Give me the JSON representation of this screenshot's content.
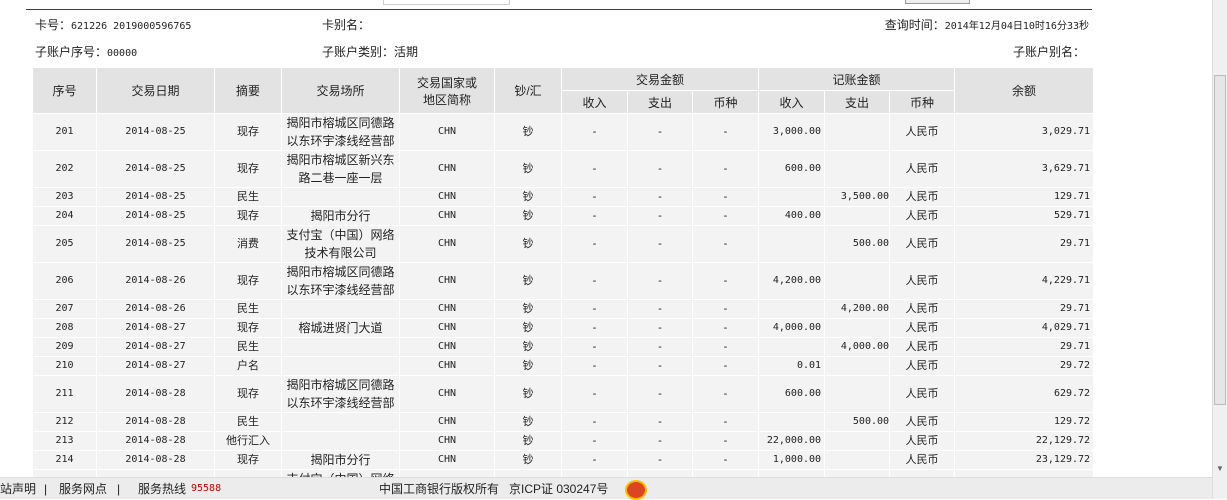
{
  "header": {
    "card_label": "卡号：",
    "card_no": "621226 2019000596765",
    "card_alias_label": "卡别名：",
    "query_time_label": "查询时间：",
    "query_time": "2014年12月04日10时16分33秒",
    "sub_no_label": "子账户序号：",
    "sub_no": "00000",
    "sub_type_label": "子账户类别：",
    "sub_type": "活期",
    "sub_alias_label": "子账户别名："
  },
  "table": {
    "headers": {
      "seq": "序号",
      "date": "交易日期",
      "summary": "摘要",
      "place": "交易场所",
      "country": "交易国家或地区简称",
      "cash": "钞/汇",
      "trade_amount": "交易金额",
      "book_amount": "记账金额",
      "balance": "余额",
      "income": "收入",
      "expense": "支出",
      "currency": "币种"
    },
    "rows": [
      [
        "201",
        "2014-08-25",
        "现存",
        "揭阳市榕城区同德路以东环宇漆线经营部",
        "CHN",
        "钞",
        "-",
        "-",
        "-",
        "3,000.00",
        "",
        "人民币",
        "3,029.71"
      ],
      [
        "202",
        "2014-08-25",
        "现存",
        "揭阳市榕城区新兴东路二巷一座一层",
        "CHN",
        "钞",
        "-",
        "-",
        "-",
        "600.00",
        "",
        "人民币",
        "3,629.71"
      ],
      [
        "203",
        "2014-08-25",
        "民生",
        "",
        "CHN",
        "钞",
        "-",
        "-",
        "-",
        "",
        "3,500.00",
        "人民币",
        "129.71"
      ],
      [
        "204",
        "2014-08-25",
        "现存",
        "揭阳市分行",
        "CHN",
        "钞",
        "-",
        "-",
        "-",
        "400.00",
        "",
        "人民币",
        "529.71"
      ],
      [
        "205",
        "2014-08-25",
        "消费",
        "支付宝（中国）网络技术有限公司",
        "CHN",
        "钞",
        "-",
        "-",
        "-",
        "",
        "500.00",
        "人民币",
        "29.71"
      ],
      [
        "206",
        "2014-08-26",
        "现存",
        "揭阳市榕城区同德路以东环宇漆线经营部",
        "CHN",
        "钞",
        "-",
        "-",
        "-",
        "4,200.00",
        "",
        "人民币",
        "4,229.71"
      ],
      [
        "207",
        "2014-08-26",
        "民生",
        "",
        "CHN",
        "钞",
        "-",
        "-",
        "-",
        "",
        "4,200.00",
        "人民币",
        "29.71"
      ],
      [
        "208",
        "2014-08-27",
        "现存",
        "榕城进贤门大道",
        "CHN",
        "钞",
        "-",
        "-",
        "-",
        "4,000.00",
        "",
        "人民币",
        "4,029.71"
      ],
      [
        "209",
        "2014-08-27",
        "民生",
        "",
        "CHN",
        "钞",
        "-",
        "-",
        "-",
        "",
        "4,000.00",
        "人民币",
        "29.71"
      ],
      [
        "210",
        "2014-08-27",
        "户名",
        "",
        "CHN",
        "钞",
        "-",
        "-",
        "-",
        "0.01",
        "",
        "人民币",
        "29.72"
      ],
      [
        "211",
        "2014-08-28",
        "现存",
        "揭阳市榕城区同德路以东环宇漆线经营部",
        "CHN",
        "钞",
        "-",
        "-",
        "-",
        "600.00",
        "",
        "人民币",
        "629.72"
      ],
      [
        "212",
        "2014-08-28",
        "民生",
        "",
        "CHN",
        "钞",
        "-",
        "-",
        "-",
        "",
        "500.00",
        "人民币",
        "129.72"
      ],
      [
        "213",
        "2014-08-28",
        "他行汇入",
        "",
        "CHN",
        "钞",
        "-",
        "-",
        "-",
        "22,000.00",
        "",
        "人民币",
        "22,129.72"
      ],
      [
        "214",
        "2014-08-28",
        "现存",
        "揭阳市分行",
        "CHN",
        "钞",
        "-",
        "-",
        "-",
        "1,000.00",
        "",
        "人民币",
        "23,129.72"
      ],
      [
        "",
        "",
        "",
        "支付宝（中国）网络",
        "",
        "",
        "",
        "",
        "",
        "",
        "",
        "",
        ""
      ]
    ]
  },
  "footer": {
    "statement": "站声明",
    "sep": "|",
    "outlets": "服务网点",
    "hotline_label": "服务热线",
    "hotline": "95588",
    "copyright": "中国工商银行版权所有",
    "icp": "京ICP证 030247号"
  }
}
